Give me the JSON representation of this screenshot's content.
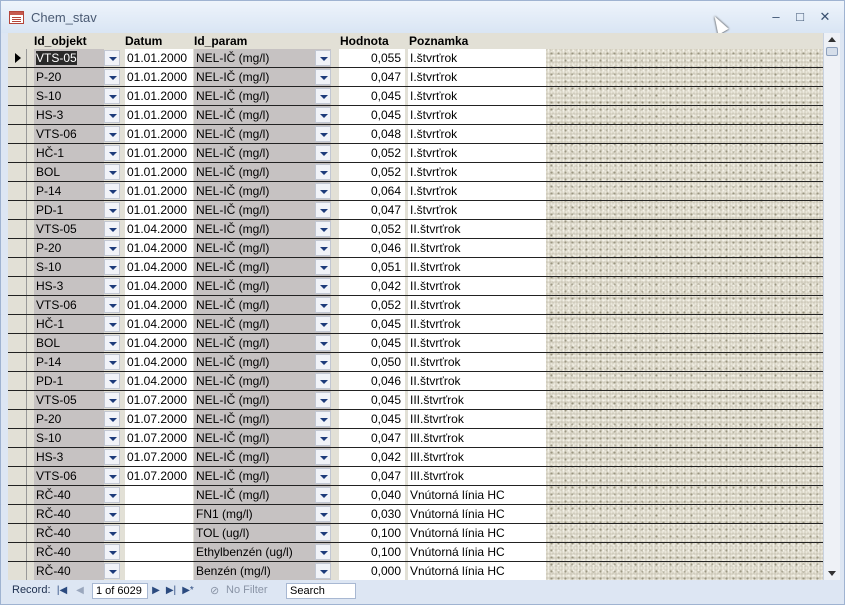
{
  "window": {
    "title": "Chem_stav",
    "minimize": "–",
    "maximize": "□",
    "close": "✕"
  },
  "columns": {
    "id_objekt": "Id_objekt",
    "datum": "Datum",
    "id_param": "Id_param",
    "hodnota": "Hodnota",
    "poznamka": "Poznamka"
  },
  "rows": [
    {
      "obj": "VTS-05",
      "dat": "01.01.2000",
      "par": "NEL-IČ (mg/l)",
      "hod": "0,055",
      "pozn": "I.štvrťrok"
    },
    {
      "obj": "P-20",
      "dat": "01.01.2000",
      "par": "NEL-IČ (mg/l)",
      "hod": "0,047",
      "pozn": "I.štvrťrok"
    },
    {
      "obj": "S-10",
      "dat": "01.01.2000",
      "par": "NEL-IČ (mg/l)",
      "hod": "0,045",
      "pozn": "I.štvrťrok"
    },
    {
      "obj": "HS-3",
      "dat": "01.01.2000",
      "par": "NEL-IČ (mg/l)",
      "hod": "0,045",
      "pozn": "I.štvrťrok"
    },
    {
      "obj": "VTS-06",
      "dat": "01.01.2000",
      "par": "NEL-IČ (mg/l)",
      "hod": "0,048",
      "pozn": "I.štvrťrok"
    },
    {
      "obj": "HČ-1",
      "dat": "01.01.2000",
      "par": "NEL-IČ (mg/l)",
      "hod": "0,052",
      "pozn": "I.štvrťrok"
    },
    {
      "obj": "BOL",
      "dat": "01.01.2000",
      "par": "NEL-IČ (mg/l)",
      "hod": "0,052",
      "pozn": "I.štvrťrok"
    },
    {
      "obj": "P-14",
      "dat": "01.01.2000",
      "par": "NEL-IČ (mg/l)",
      "hod": "0,064",
      "pozn": "I.štvrťrok"
    },
    {
      "obj": "PD-1",
      "dat": "01.01.2000",
      "par": "NEL-IČ (mg/l)",
      "hod": "0,047",
      "pozn": "I.štvrťrok"
    },
    {
      "obj": "VTS-05",
      "dat": "01.04.2000",
      "par": "NEL-IČ (mg/l)",
      "hod": "0,052",
      "pozn": "II.štvrťrok"
    },
    {
      "obj": "P-20",
      "dat": "01.04.2000",
      "par": "NEL-IČ (mg/l)",
      "hod": "0,046",
      "pozn": "II.štvrťrok"
    },
    {
      "obj": "S-10",
      "dat": "01.04.2000",
      "par": "NEL-IČ (mg/l)",
      "hod": "0,051",
      "pozn": "II.štvrťrok"
    },
    {
      "obj": "HS-3",
      "dat": "01.04.2000",
      "par": "NEL-IČ (mg/l)",
      "hod": "0,042",
      "pozn": "II.štvrťrok"
    },
    {
      "obj": "VTS-06",
      "dat": "01.04.2000",
      "par": "NEL-IČ (mg/l)",
      "hod": "0,052",
      "pozn": "II.štvrťrok"
    },
    {
      "obj": "HČ-1",
      "dat": "01.04.2000",
      "par": "NEL-IČ (mg/l)",
      "hod": "0,045",
      "pozn": "II.štvrťrok"
    },
    {
      "obj": "BOL",
      "dat": "01.04.2000",
      "par": "NEL-IČ (mg/l)",
      "hod": "0,045",
      "pozn": "II.štvrťrok"
    },
    {
      "obj": "P-14",
      "dat": "01.04.2000",
      "par": "NEL-IČ (mg/l)",
      "hod": "0,050",
      "pozn": "II.štvrťrok"
    },
    {
      "obj": "PD-1",
      "dat": "01.04.2000",
      "par": "NEL-IČ (mg/l)",
      "hod": "0,046",
      "pozn": "II.štvrťrok"
    },
    {
      "obj": "VTS-05",
      "dat": "01.07.2000",
      "par": "NEL-IČ (mg/l)",
      "hod": "0,045",
      "pozn": "III.štvrťrok"
    },
    {
      "obj": "P-20",
      "dat": "01.07.2000",
      "par": "NEL-IČ (mg/l)",
      "hod": "0,045",
      "pozn": "III.štvrťrok"
    },
    {
      "obj": "S-10",
      "dat": "01.07.2000",
      "par": "NEL-IČ (mg/l)",
      "hod": "0,047",
      "pozn": "III.štvrťrok"
    },
    {
      "obj": "HS-3",
      "dat": "01.07.2000",
      "par": "NEL-IČ (mg/l)",
      "hod": "0,042",
      "pozn": "III.štvrťrok"
    },
    {
      "obj": "VTS-06",
      "dat": "01.07.2000",
      "par": "NEL-IČ (mg/l)",
      "hod": "0,047",
      "pozn": "III.štvrťrok"
    },
    {
      "obj": "RČ-40",
      "dat": "",
      "par": "NEL-IČ (mg/l)",
      "hod": "0,040",
      "pozn": "Vnútorná línia HC"
    },
    {
      "obj": "RČ-40",
      "dat": "",
      "par": "FN1 (mg/l)",
      "hod": "0,030",
      "pozn": "Vnútorná línia HC"
    },
    {
      "obj": "RČ-40",
      "dat": "",
      "par": "TOL (ug/l)",
      "hod": "0,100",
      "pozn": "Vnútorná línia HC"
    },
    {
      "obj": "RČ-40",
      "dat": "",
      "par": "Ethylbenzén (ug/l)",
      "hod": "0,100",
      "pozn": "Vnútorná línia HC"
    },
    {
      "obj": "RČ-40",
      "dat": "",
      "par": "Benzén (mg/l)",
      "hod": "0,000",
      "pozn": "Vnútorná línia HC"
    }
  ],
  "navigation": {
    "record_label": "Record:",
    "first": "|◀",
    "prev": "◀",
    "current": "1 of 6029",
    "next": "▶",
    "last": "▶|",
    "new": "▶*",
    "filter_icon": "funnel-icon",
    "filter_label": "No Filter",
    "search_placeholder": "Search"
  }
}
